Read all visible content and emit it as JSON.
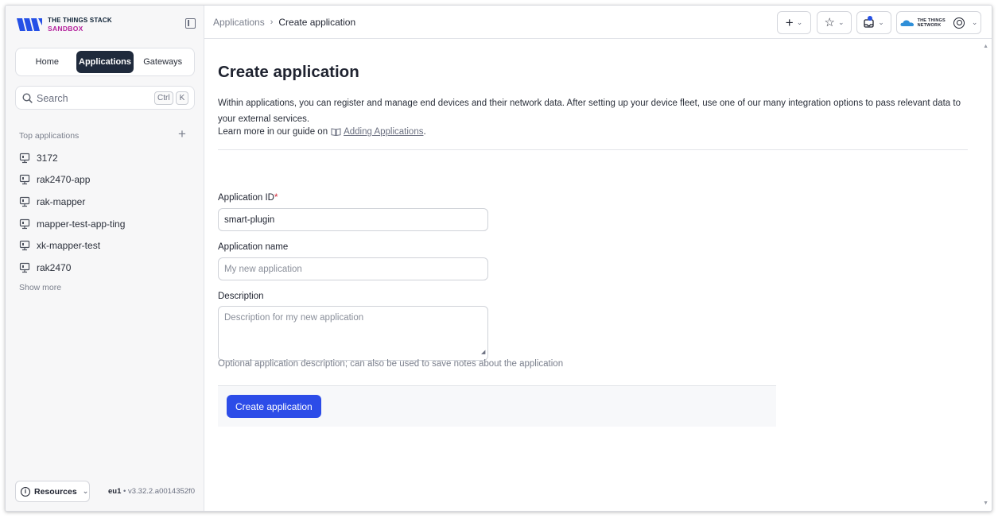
{
  "brand": {
    "title": "THE THINGS STACK",
    "subtitle": "SANDBOX"
  },
  "sidebar": {
    "tabs": [
      {
        "label": "Home"
      },
      {
        "label": "Applications"
      },
      {
        "label": "Gateways"
      }
    ],
    "active_tab": "Applications",
    "search": {
      "placeholder": "Search",
      "shortcut_ctrl": "Ctrl",
      "shortcut_key": "K"
    },
    "top_apps_title": "Top applications",
    "top_apps": [
      {
        "label": "3172"
      },
      {
        "label": "rak2470-app"
      },
      {
        "label": "rak-mapper"
      },
      {
        "label": "mapper-test-app-ting"
      },
      {
        "label": "xk-mapper-test"
      },
      {
        "label": "rak2470"
      }
    ],
    "show_more": "Show more",
    "resources_label": "Resources",
    "cluster": "eu1",
    "version_sep": " • ",
    "version": "v3.32.2.a0014352f0"
  },
  "header": {
    "breadcrumb": [
      {
        "label": "Applications"
      },
      {
        "label": "Create application"
      }
    ],
    "breadcrumb_separator": "›",
    "partner_logo_top": "THE THINGS",
    "partner_logo_bottom": "NETWORK",
    "icons": [
      "plus-icon",
      "star-icon",
      "notifications-icon",
      "user-icon"
    ]
  },
  "main": {
    "title": "Create application",
    "intro": "Within applications, you can register and manage end devices and their network data. After setting up your device fleet, use one of our many integration options to pass relevant data to your external services.",
    "guide_prefix": "Learn more in our guide on",
    "guide_link": "Adding Applications",
    "guide_suffix": ".",
    "form": {
      "app_id_label": "Application ID",
      "required_mark": "*",
      "app_id_value": "smart-plugin",
      "app_name_label": "Application name",
      "app_name_placeholder": "My new application",
      "description_label": "Description",
      "description_placeholder": "Description for my new application",
      "description_hint": "Optional application description; can also be used to save notes about the application",
      "submit_label": "Create application"
    }
  },
  "colors": {
    "primary": "#2c4ce8",
    "nav_active": "#1f2a3c",
    "brand_accent": "#b4229d",
    "brand_blue": "#2550e6",
    "required": "#d1293a"
  }
}
